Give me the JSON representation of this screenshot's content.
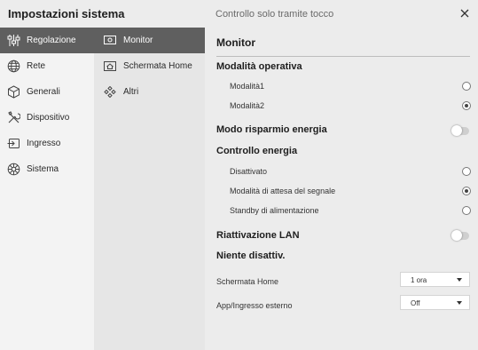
{
  "header": {
    "title": "Impostazioni sistema",
    "subtitle": "Controllo solo tramite tocco",
    "close_icon": "close-icon"
  },
  "nav_primary": [
    {
      "label": "Regolazione",
      "icon": "sliders-icon",
      "active": true
    },
    {
      "label": "Rete",
      "icon": "globe-icon",
      "active": false
    },
    {
      "label": "Generali",
      "icon": "cube-icon",
      "active": false
    },
    {
      "label": "Dispositivo",
      "icon": "tools-icon",
      "active": false
    },
    {
      "label": "Ingresso",
      "icon": "input-icon",
      "active": false
    },
    {
      "label": "Sistema",
      "icon": "system-icon",
      "active": false
    }
  ],
  "nav_secondary": [
    {
      "label": "Monitor",
      "icon": "monitor-icon",
      "active": true
    },
    {
      "label": "Schermata Home",
      "icon": "home-icon",
      "active": false
    },
    {
      "label": "Altri",
      "icon": "more-icon",
      "active": false
    }
  ],
  "panel": {
    "title": "Monitor",
    "operating_mode": {
      "title": "Modalità operativa",
      "options": [
        {
          "label": "Modalità1",
          "selected": false
        },
        {
          "label": "Modalità2",
          "selected": true
        }
      ]
    },
    "energy_saving": {
      "label": "Modo risparmio energia",
      "on": false
    },
    "power_control": {
      "title": "Controllo energia",
      "options": [
        {
          "label": "Disattivato",
          "selected": false
        },
        {
          "label": "Modalità di attesa del segnale",
          "selected": true
        },
        {
          "label": "Standby di alimentazione",
          "selected": false
        }
      ]
    },
    "lan_wake": {
      "label": "Riattivazione LAN",
      "on": false
    },
    "no_off": {
      "title": "Niente disattiv.",
      "rows": [
        {
          "label": "Schermata Home",
          "value": "1 ora"
        },
        {
          "label": "App/Ingresso esterno",
          "value": "Off"
        }
      ]
    }
  },
  "colors": {
    "active_nav": "#5f5f5f",
    "titlebar": "#ececec",
    "col1_bg": "#f3f3f3",
    "col2_bg": "#e6e6e6",
    "main_bg": "#ececec"
  }
}
